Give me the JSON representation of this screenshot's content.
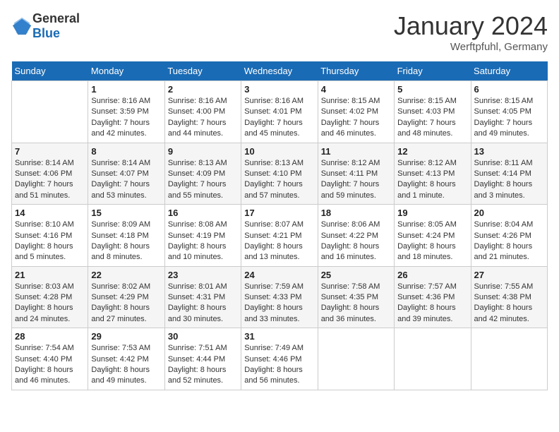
{
  "logo": {
    "general": "General",
    "blue": "Blue"
  },
  "title": "January 2024",
  "location": "Werftpfuhl, Germany",
  "days_of_week": [
    "Sunday",
    "Monday",
    "Tuesday",
    "Wednesday",
    "Thursday",
    "Friday",
    "Saturday"
  ],
  "weeks": [
    [
      {
        "day": "",
        "sunrise": "",
        "sunset": "",
        "daylight": ""
      },
      {
        "day": "1",
        "sunrise": "Sunrise: 8:16 AM",
        "sunset": "Sunset: 3:59 PM",
        "daylight": "Daylight: 7 hours and 42 minutes."
      },
      {
        "day": "2",
        "sunrise": "Sunrise: 8:16 AM",
        "sunset": "Sunset: 4:00 PM",
        "daylight": "Daylight: 7 hours and 44 minutes."
      },
      {
        "day": "3",
        "sunrise": "Sunrise: 8:16 AM",
        "sunset": "Sunset: 4:01 PM",
        "daylight": "Daylight: 7 hours and 45 minutes."
      },
      {
        "day": "4",
        "sunrise": "Sunrise: 8:15 AM",
        "sunset": "Sunset: 4:02 PM",
        "daylight": "Daylight: 7 hours and 46 minutes."
      },
      {
        "day": "5",
        "sunrise": "Sunrise: 8:15 AM",
        "sunset": "Sunset: 4:03 PM",
        "daylight": "Daylight: 7 hours and 48 minutes."
      },
      {
        "day": "6",
        "sunrise": "Sunrise: 8:15 AM",
        "sunset": "Sunset: 4:05 PM",
        "daylight": "Daylight: 7 hours and 49 minutes."
      }
    ],
    [
      {
        "day": "7",
        "sunrise": "Sunrise: 8:14 AM",
        "sunset": "Sunset: 4:06 PM",
        "daylight": "Daylight: 7 hours and 51 minutes."
      },
      {
        "day": "8",
        "sunrise": "Sunrise: 8:14 AM",
        "sunset": "Sunset: 4:07 PM",
        "daylight": "Daylight: 7 hours and 53 minutes."
      },
      {
        "day": "9",
        "sunrise": "Sunrise: 8:13 AM",
        "sunset": "Sunset: 4:09 PM",
        "daylight": "Daylight: 7 hours and 55 minutes."
      },
      {
        "day": "10",
        "sunrise": "Sunrise: 8:13 AM",
        "sunset": "Sunset: 4:10 PM",
        "daylight": "Daylight: 7 hours and 57 minutes."
      },
      {
        "day": "11",
        "sunrise": "Sunrise: 8:12 AM",
        "sunset": "Sunset: 4:11 PM",
        "daylight": "Daylight: 7 hours and 59 minutes."
      },
      {
        "day": "12",
        "sunrise": "Sunrise: 8:12 AM",
        "sunset": "Sunset: 4:13 PM",
        "daylight": "Daylight: 8 hours and 1 minute."
      },
      {
        "day": "13",
        "sunrise": "Sunrise: 8:11 AM",
        "sunset": "Sunset: 4:14 PM",
        "daylight": "Daylight: 8 hours and 3 minutes."
      }
    ],
    [
      {
        "day": "14",
        "sunrise": "Sunrise: 8:10 AM",
        "sunset": "Sunset: 4:16 PM",
        "daylight": "Daylight: 8 hours and 5 minutes."
      },
      {
        "day": "15",
        "sunrise": "Sunrise: 8:09 AM",
        "sunset": "Sunset: 4:18 PM",
        "daylight": "Daylight: 8 hours and 8 minutes."
      },
      {
        "day": "16",
        "sunrise": "Sunrise: 8:08 AM",
        "sunset": "Sunset: 4:19 PM",
        "daylight": "Daylight: 8 hours and 10 minutes."
      },
      {
        "day": "17",
        "sunrise": "Sunrise: 8:07 AM",
        "sunset": "Sunset: 4:21 PM",
        "daylight": "Daylight: 8 hours and 13 minutes."
      },
      {
        "day": "18",
        "sunrise": "Sunrise: 8:06 AM",
        "sunset": "Sunset: 4:22 PM",
        "daylight": "Daylight: 8 hours and 16 minutes."
      },
      {
        "day": "19",
        "sunrise": "Sunrise: 8:05 AM",
        "sunset": "Sunset: 4:24 PM",
        "daylight": "Daylight: 8 hours and 18 minutes."
      },
      {
        "day": "20",
        "sunrise": "Sunrise: 8:04 AM",
        "sunset": "Sunset: 4:26 PM",
        "daylight": "Daylight: 8 hours and 21 minutes."
      }
    ],
    [
      {
        "day": "21",
        "sunrise": "Sunrise: 8:03 AM",
        "sunset": "Sunset: 4:28 PM",
        "daylight": "Daylight: 8 hours and 24 minutes."
      },
      {
        "day": "22",
        "sunrise": "Sunrise: 8:02 AM",
        "sunset": "Sunset: 4:29 PM",
        "daylight": "Daylight: 8 hours and 27 minutes."
      },
      {
        "day": "23",
        "sunrise": "Sunrise: 8:01 AM",
        "sunset": "Sunset: 4:31 PM",
        "daylight": "Daylight: 8 hours and 30 minutes."
      },
      {
        "day": "24",
        "sunrise": "Sunrise: 7:59 AM",
        "sunset": "Sunset: 4:33 PM",
        "daylight": "Daylight: 8 hours and 33 minutes."
      },
      {
        "day": "25",
        "sunrise": "Sunrise: 7:58 AM",
        "sunset": "Sunset: 4:35 PM",
        "daylight": "Daylight: 8 hours and 36 minutes."
      },
      {
        "day": "26",
        "sunrise": "Sunrise: 7:57 AM",
        "sunset": "Sunset: 4:36 PM",
        "daylight": "Daylight: 8 hours and 39 minutes."
      },
      {
        "day": "27",
        "sunrise": "Sunrise: 7:55 AM",
        "sunset": "Sunset: 4:38 PM",
        "daylight": "Daylight: 8 hours and 42 minutes."
      }
    ],
    [
      {
        "day": "28",
        "sunrise": "Sunrise: 7:54 AM",
        "sunset": "Sunset: 4:40 PM",
        "daylight": "Daylight: 8 hours and 46 minutes."
      },
      {
        "day": "29",
        "sunrise": "Sunrise: 7:53 AM",
        "sunset": "Sunset: 4:42 PM",
        "daylight": "Daylight: 8 hours and 49 minutes."
      },
      {
        "day": "30",
        "sunrise": "Sunrise: 7:51 AM",
        "sunset": "Sunset: 4:44 PM",
        "daylight": "Daylight: 8 hours and 52 minutes."
      },
      {
        "day": "31",
        "sunrise": "Sunrise: 7:49 AM",
        "sunset": "Sunset: 4:46 PM",
        "daylight": "Daylight: 8 hours and 56 minutes."
      },
      {
        "day": "",
        "sunrise": "",
        "sunset": "",
        "daylight": ""
      },
      {
        "day": "",
        "sunrise": "",
        "sunset": "",
        "daylight": ""
      },
      {
        "day": "",
        "sunrise": "",
        "sunset": "",
        "daylight": ""
      }
    ]
  ]
}
